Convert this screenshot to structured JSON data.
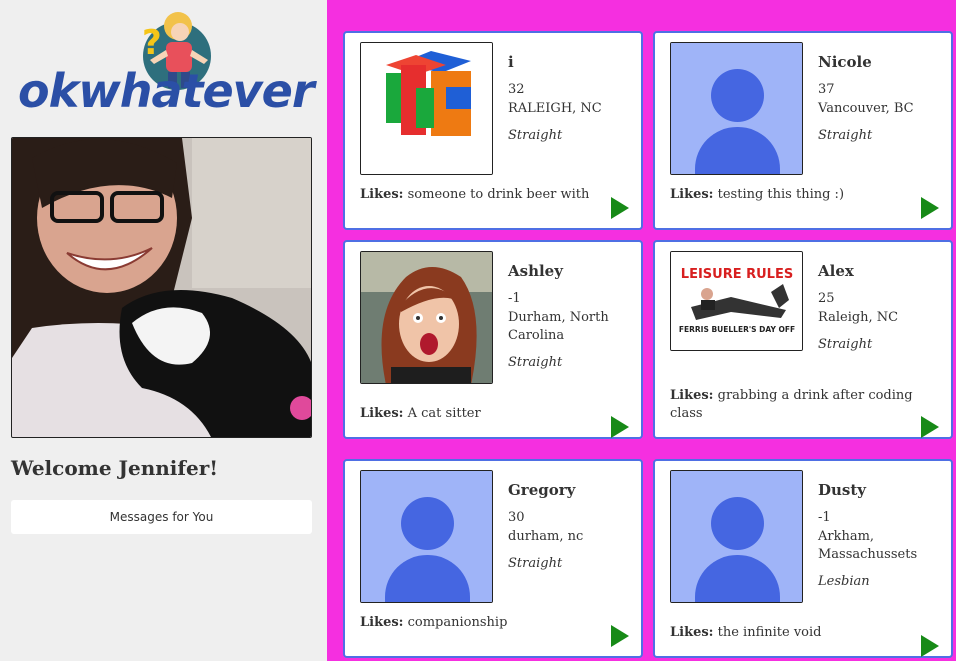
{
  "sidebar": {
    "logo": {
      "ok": "ok",
      "whatever": "whatever"
    },
    "welcome": "Welcome Jennifer!",
    "messages_button": "Messages for You"
  },
  "profiles": [
    {
      "name": "i",
      "age": "32",
      "location": "RALEIGH, NC",
      "orientation": "Straight",
      "likes_label": "Likes:",
      "likes": "someone to drink beer with",
      "avatar": "logo-cube"
    },
    {
      "name": "Nicole",
      "age": "37",
      "location": "Vancouver, BC",
      "orientation": "Straight",
      "likes_label": "Likes:",
      "likes": "testing this thing :)",
      "avatar": "default-avatar"
    },
    {
      "name": "Ashley",
      "age": "-1",
      "location": "Durham, North Carolina",
      "orientation": "Straight",
      "likes_label": "Likes:",
      "likes": "A cat sitter",
      "avatar": "photo"
    },
    {
      "name": "Alex",
      "age": "25",
      "location": "Raleigh, NC",
      "orientation": "Straight",
      "likes_label": "Likes:",
      "likes": "grabbing a drink after coding class",
      "avatar": "movie-poster",
      "poster_title": "LEISURE RULES",
      "poster_subtitle": "FERRIS BUELLER'S DAY OFF"
    },
    {
      "name": "Gregory",
      "age": "30",
      "location": "durham, nc",
      "orientation": "Straight",
      "likes_label": "Likes:",
      "likes": "companionship",
      "avatar": "default-avatar"
    },
    {
      "name": "Dusty",
      "age": "-1",
      "location": "Arkham, Massachussets",
      "orientation": "Lesbian",
      "likes_label": "Likes:",
      "likes": "the infinite void",
      "avatar": "default-avatar"
    }
  ],
  "colors": {
    "main_bg": "#f52fe0",
    "card_border": "#4f6fe4",
    "play_icon": "#178a17",
    "avatar_bg": "#9fb4f8",
    "avatar_fg": "#4566e1"
  }
}
